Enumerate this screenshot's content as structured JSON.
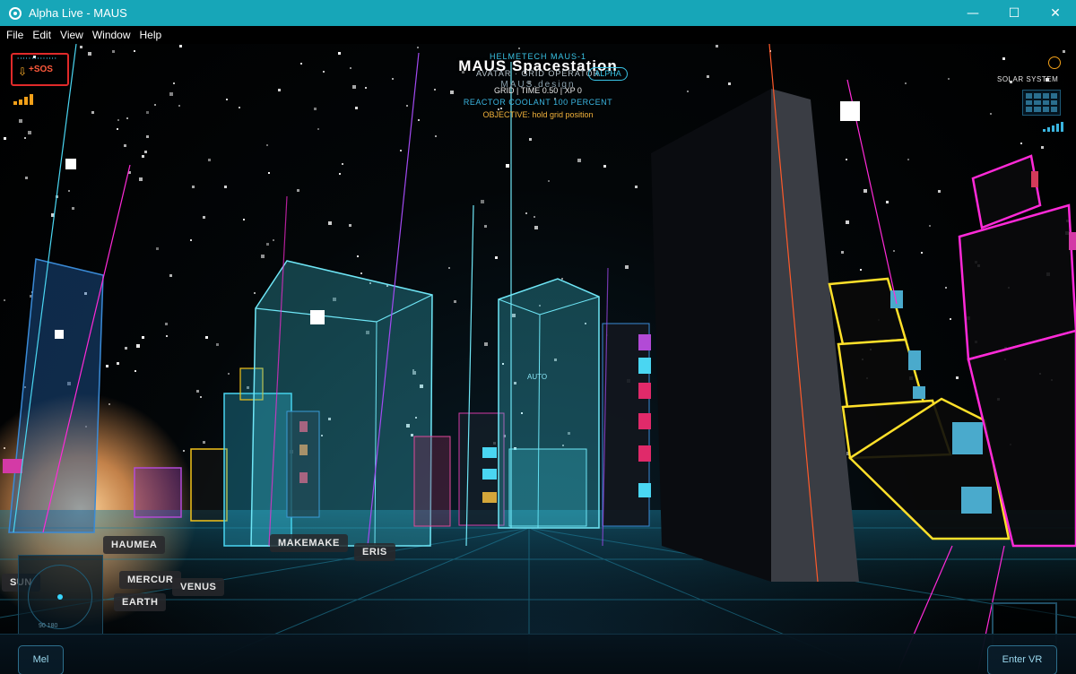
{
  "window": {
    "title": "Alpha Live - MAUS",
    "minimize": "—",
    "maximize": "☐",
    "close": "✕"
  },
  "menu": [
    "File",
    "Edit",
    "View",
    "Window",
    "Help"
  ],
  "hud": {
    "sos_label": "+SOS",
    "sos_dots": "''''''''''''''",
    "helmet": "HELMETECH MAUS-1",
    "station": "MAUS Spacestation",
    "avatar_line": "AVATAR · GRID OPERATOR",
    "badge": "ALPHA",
    "design": "MAUS.design",
    "grid_line": "GRID | TIME 0.50 | XP 0",
    "coolant": "REACTOR COOLANT 100 PERCENT",
    "objective": "OBJECTIVE: hold grid position",
    "solar_label": "SOLAR SYSTEM",
    "auto_label": "AUTO"
  },
  "planets": {
    "haumea": "HAUMEA",
    "makemake": "MAKEMAKE",
    "eris": "ERIS",
    "sun": "SUN",
    "mercury": "MERCUR",
    "venus": "VENUS",
    "earth": "EARTH"
  },
  "minimap": {
    "label": "90 180"
  },
  "bottom": {
    "mel": "Mel",
    "enter_vr": "Enter VR"
  },
  "colors": {
    "titlebar": "#17a6b8",
    "cyan": "#3ad6f2",
    "magenta": "#ff2ad8",
    "yellow": "#ffe02a",
    "orange": "#f2a019",
    "sos_red": "#e02a2a"
  }
}
